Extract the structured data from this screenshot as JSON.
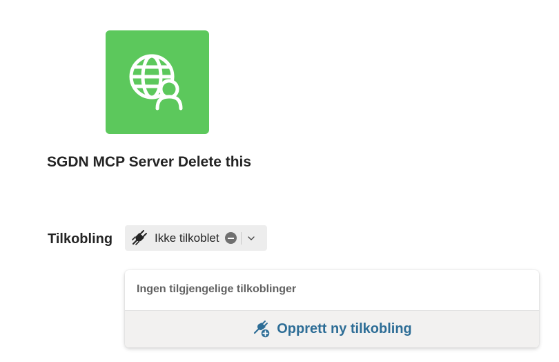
{
  "app": {
    "title": "SGDN MCP Server Delete this",
    "icon": "globe-person-icon",
    "icon_bg": "#5cc85c"
  },
  "connection": {
    "label": "Tilkobling",
    "status": "Ikke tilkoblet",
    "status_icon": "minus-circle-icon",
    "plug_icon": "plug-disconnected-icon"
  },
  "dropdown": {
    "empty_message": "Ingen tilgjengelige tilkoblinger",
    "create_label": "Opprett ny tilkobling",
    "create_icon": "plug-add-icon",
    "accent": "#2d6d96"
  }
}
